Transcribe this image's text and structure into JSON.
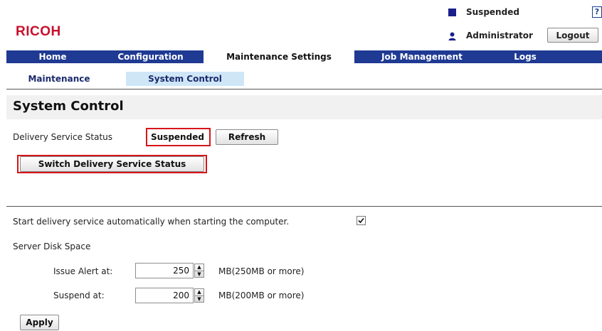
{
  "brand": {
    "logo": "RICOH",
    "color": "#c8102e"
  },
  "topbar": {
    "status": "Suspended",
    "status_color": "#1b1f8c",
    "help": "?",
    "user": "Administrator",
    "logout": "Logout"
  },
  "nav": {
    "tabs": [
      {
        "label": "Home"
      },
      {
        "label": "Configuration"
      },
      {
        "label": "Maintenance Settings",
        "active": true
      },
      {
        "label": "Job Management"
      },
      {
        "label": "Logs"
      }
    ],
    "subtabs": [
      {
        "label": "Maintenance"
      },
      {
        "label": "System Control",
        "active": true
      }
    ]
  },
  "page": {
    "title": "System Control",
    "delivery_status_label": "Delivery Service Status",
    "delivery_status_value": "Suspended",
    "refresh_label": "Refresh",
    "switch_label": "Switch Delivery Service Status",
    "autostart_label": "Start delivery service automatically when starting the computer.",
    "autostart_checked": true,
    "disk_space_label": "Server Disk Space",
    "alert_label": "Issue Alert at:",
    "alert_value": "250",
    "alert_hint": "MB(250MB or more)",
    "suspend_label": "Suspend at:",
    "suspend_value": "200",
    "suspend_hint": "MB(200MB or more)",
    "apply_label": "Apply"
  },
  "accent": {
    "nav": "#1f3a93",
    "highlight": "#d7141a",
    "subtab_active": "#cfe6f7"
  }
}
